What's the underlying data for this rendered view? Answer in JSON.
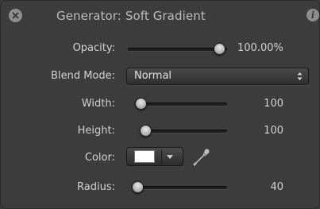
{
  "window": {
    "title": "Generator: Soft Gradient",
    "close_icon": "close-icon",
    "info_icon": "info-icon",
    "info_glyph": "i"
  },
  "params": {
    "opacity": {
      "label": "Opacity:",
      "value": "100.00%",
      "level": 1.0
    },
    "blend_mode": {
      "label": "Blend Mode:",
      "value": "Normal"
    },
    "width": {
      "label": "Width:",
      "value": "100",
      "level": 0.0
    },
    "height": {
      "label": "Height:",
      "value": "100",
      "level": 0.0
    },
    "color": {
      "label": "Color:",
      "swatch": "#ffffff",
      "eyedropper_icon": "eyedropper-icon"
    },
    "radius": {
      "label": "Radius:",
      "value": "40",
      "level": 0.0
    }
  }
}
